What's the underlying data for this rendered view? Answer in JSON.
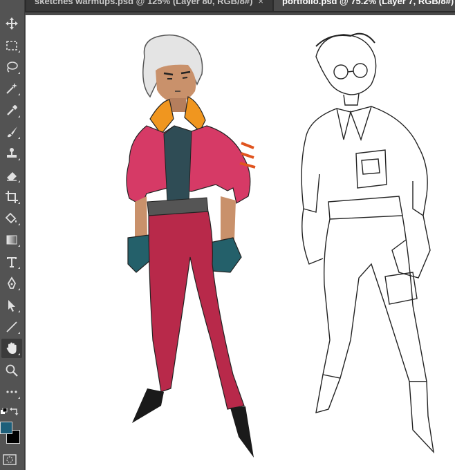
{
  "tabs": [
    {
      "label": "sketches warmups.psd @ 125% (Layer 80, RGB/8#)",
      "close": "×",
      "active": false
    },
    {
      "label": "portfolio.psd @ 75.2% (Layer 7, RGB/8#)",
      "close": "",
      "active": true
    }
  ],
  "tools": [
    {
      "name": "move-tool",
      "icon": "move-icon"
    },
    {
      "name": "marquee-tool",
      "icon": "marquee-icon"
    },
    {
      "name": "lasso-tool",
      "icon": "lasso-icon"
    },
    {
      "name": "magic-wand-tool",
      "icon": "magic-wand-icon"
    },
    {
      "name": "eyedropper-tool",
      "icon": "eyedropper-icon"
    },
    {
      "name": "brush-tool",
      "icon": "brush-icon"
    },
    {
      "name": "stamp-tool",
      "icon": "stamp-icon"
    },
    {
      "name": "eraser-tool",
      "icon": "eraser-icon"
    },
    {
      "name": "crop-tool",
      "icon": "crop-icon"
    },
    {
      "name": "paint-bucket-tool",
      "icon": "paint-bucket-icon"
    },
    {
      "name": "gradient-tool",
      "icon": "gradient-icon"
    },
    {
      "name": "type-tool",
      "icon": "type-icon"
    },
    {
      "name": "pen-tool",
      "icon": "pen-icon"
    },
    {
      "name": "path-selection-tool",
      "icon": "arrow-icon"
    },
    {
      "name": "line-tool",
      "icon": "line-icon"
    },
    {
      "name": "hand-tool",
      "icon": "hand-icon",
      "active": true
    },
    {
      "name": "zoom-tool",
      "icon": "zoom-icon"
    },
    {
      "name": "more-tools",
      "icon": "ellipsis-icon"
    }
  ],
  "colors": {
    "foreground": "#1e5f7a",
    "background": "#000000",
    "canvas": "#ffffff",
    "ui_dark": "#2b2b2b",
    "ui_panel": "#535353"
  },
  "canvas": {
    "content": "character sketches: red-suit colored figure and line-art figure"
  }
}
